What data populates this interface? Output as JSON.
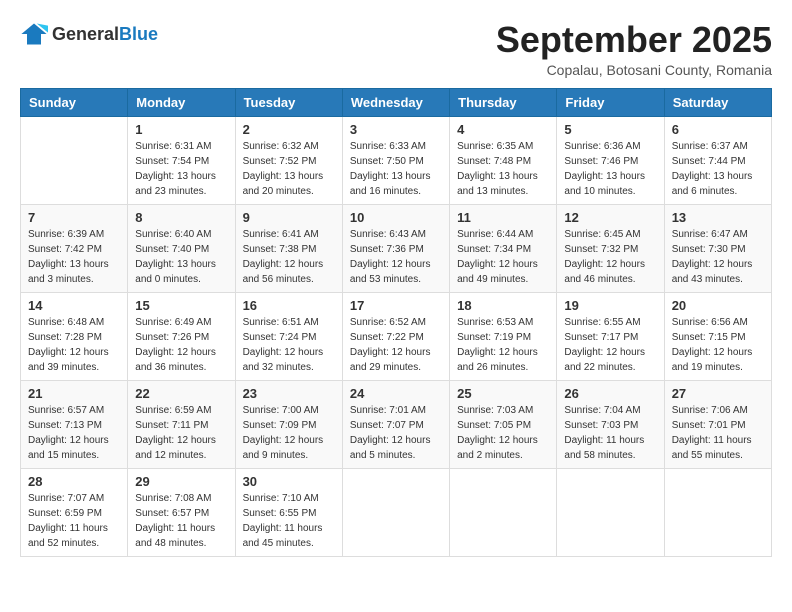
{
  "logo": {
    "general": "General",
    "blue": "Blue"
  },
  "title": "September 2025",
  "subtitle": "Copalau, Botosani County, Romania",
  "days_of_week": [
    "Sunday",
    "Monday",
    "Tuesday",
    "Wednesday",
    "Thursday",
    "Friday",
    "Saturday"
  ],
  "weeks": [
    [
      {
        "day": "",
        "info": ""
      },
      {
        "day": "1",
        "info": "Sunrise: 6:31 AM\nSunset: 7:54 PM\nDaylight: 13 hours\nand 23 minutes."
      },
      {
        "day": "2",
        "info": "Sunrise: 6:32 AM\nSunset: 7:52 PM\nDaylight: 13 hours\nand 20 minutes."
      },
      {
        "day": "3",
        "info": "Sunrise: 6:33 AM\nSunset: 7:50 PM\nDaylight: 13 hours\nand 16 minutes."
      },
      {
        "day": "4",
        "info": "Sunrise: 6:35 AM\nSunset: 7:48 PM\nDaylight: 13 hours\nand 13 minutes."
      },
      {
        "day": "5",
        "info": "Sunrise: 6:36 AM\nSunset: 7:46 PM\nDaylight: 13 hours\nand 10 minutes."
      },
      {
        "day": "6",
        "info": "Sunrise: 6:37 AM\nSunset: 7:44 PM\nDaylight: 13 hours\nand 6 minutes."
      }
    ],
    [
      {
        "day": "7",
        "info": "Sunrise: 6:39 AM\nSunset: 7:42 PM\nDaylight: 13 hours\nand 3 minutes."
      },
      {
        "day": "8",
        "info": "Sunrise: 6:40 AM\nSunset: 7:40 PM\nDaylight: 13 hours\nand 0 minutes."
      },
      {
        "day": "9",
        "info": "Sunrise: 6:41 AM\nSunset: 7:38 PM\nDaylight: 12 hours\nand 56 minutes."
      },
      {
        "day": "10",
        "info": "Sunrise: 6:43 AM\nSunset: 7:36 PM\nDaylight: 12 hours\nand 53 minutes."
      },
      {
        "day": "11",
        "info": "Sunrise: 6:44 AM\nSunset: 7:34 PM\nDaylight: 12 hours\nand 49 minutes."
      },
      {
        "day": "12",
        "info": "Sunrise: 6:45 AM\nSunset: 7:32 PM\nDaylight: 12 hours\nand 46 minutes."
      },
      {
        "day": "13",
        "info": "Sunrise: 6:47 AM\nSunset: 7:30 PM\nDaylight: 12 hours\nand 43 minutes."
      }
    ],
    [
      {
        "day": "14",
        "info": "Sunrise: 6:48 AM\nSunset: 7:28 PM\nDaylight: 12 hours\nand 39 minutes."
      },
      {
        "day": "15",
        "info": "Sunrise: 6:49 AM\nSunset: 7:26 PM\nDaylight: 12 hours\nand 36 minutes."
      },
      {
        "day": "16",
        "info": "Sunrise: 6:51 AM\nSunset: 7:24 PM\nDaylight: 12 hours\nand 32 minutes."
      },
      {
        "day": "17",
        "info": "Sunrise: 6:52 AM\nSunset: 7:22 PM\nDaylight: 12 hours\nand 29 minutes."
      },
      {
        "day": "18",
        "info": "Sunrise: 6:53 AM\nSunset: 7:19 PM\nDaylight: 12 hours\nand 26 minutes."
      },
      {
        "day": "19",
        "info": "Sunrise: 6:55 AM\nSunset: 7:17 PM\nDaylight: 12 hours\nand 22 minutes."
      },
      {
        "day": "20",
        "info": "Sunrise: 6:56 AM\nSunset: 7:15 PM\nDaylight: 12 hours\nand 19 minutes."
      }
    ],
    [
      {
        "day": "21",
        "info": "Sunrise: 6:57 AM\nSunset: 7:13 PM\nDaylight: 12 hours\nand 15 minutes."
      },
      {
        "day": "22",
        "info": "Sunrise: 6:59 AM\nSunset: 7:11 PM\nDaylight: 12 hours\nand 12 minutes."
      },
      {
        "day": "23",
        "info": "Sunrise: 7:00 AM\nSunset: 7:09 PM\nDaylight: 12 hours\nand 9 minutes."
      },
      {
        "day": "24",
        "info": "Sunrise: 7:01 AM\nSunset: 7:07 PM\nDaylight: 12 hours\nand 5 minutes."
      },
      {
        "day": "25",
        "info": "Sunrise: 7:03 AM\nSunset: 7:05 PM\nDaylight: 12 hours\nand 2 minutes."
      },
      {
        "day": "26",
        "info": "Sunrise: 7:04 AM\nSunset: 7:03 PM\nDaylight: 11 hours\nand 58 minutes."
      },
      {
        "day": "27",
        "info": "Sunrise: 7:06 AM\nSunset: 7:01 PM\nDaylight: 11 hours\nand 55 minutes."
      }
    ],
    [
      {
        "day": "28",
        "info": "Sunrise: 7:07 AM\nSunset: 6:59 PM\nDaylight: 11 hours\nand 52 minutes."
      },
      {
        "day": "29",
        "info": "Sunrise: 7:08 AM\nSunset: 6:57 PM\nDaylight: 11 hours\nand 48 minutes."
      },
      {
        "day": "30",
        "info": "Sunrise: 7:10 AM\nSunset: 6:55 PM\nDaylight: 11 hours\nand 45 minutes."
      },
      {
        "day": "",
        "info": ""
      },
      {
        "day": "",
        "info": ""
      },
      {
        "day": "",
        "info": ""
      },
      {
        "day": "",
        "info": ""
      }
    ]
  ]
}
